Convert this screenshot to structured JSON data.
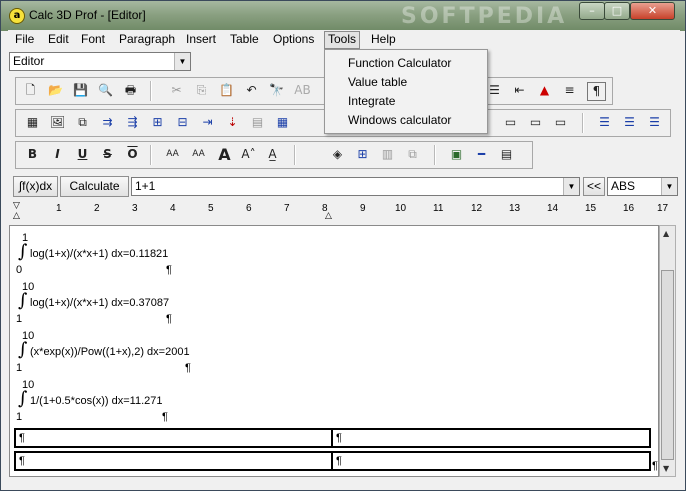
{
  "window": {
    "title": "Calc 3D Prof - [Editor]",
    "watermark": "SOFTPEDIA",
    "caption_minimize": "–",
    "caption_maximize": "□",
    "caption_close": "✕"
  },
  "menubar": [
    "File",
    "Edit",
    "Font",
    "Paragraph",
    "Insert",
    "Table",
    "Options",
    "Tools",
    "Help"
  ],
  "style_combo": {
    "value": "Editor"
  },
  "tools_menu": {
    "items": [
      "Function Calculator",
      "Value table",
      "Integrate",
      "Windows calculator"
    ]
  },
  "formula_bar": {
    "integral_button": "∫f(x)dx",
    "calculate_button": "Calculate",
    "expression": "1+1",
    "back_button": "<<",
    "function_combo": "ABS"
  },
  "ruler": {
    "labels": [
      "1",
      "2",
      "3",
      "4",
      "5",
      "6",
      "7",
      "8",
      "9",
      "10",
      "11",
      "12",
      "13",
      "14",
      "15",
      "16",
      "17"
    ]
  },
  "document": {
    "integrals": [
      {
        "upper": "1",
        "lower": "0",
        "expression": "log(1+x)/(x*x+1) dx=0.11821"
      },
      {
        "upper": "10",
        "lower": "1",
        "expression": "log(1+x)/(x*x+1) dx=0.37087"
      },
      {
        "upper": "10",
        "lower": "1",
        "expression": "(x*exp(x))/Pow((1+x),2) dx=2001"
      },
      {
        "upper": "10",
        "lower": "1",
        "expression": "1/(1+0.5*cos(x)) dx=11.271"
      }
    ],
    "pilcrow": "¶",
    "table_cells": [
      "¶",
      "¶",
      "¶",
      "¶"
    ]
  },
  "icons": {
    "toolbar1": [
      "new-file",
      "open-folder",
      "save",
      "print-preview",
      "print",
      "cut",
      "copy",
      "paste",
      "undo",
      "find",
      "spell-check",
      "align-right",
      "indent",
      "fill-color",
      "styles",
      "paragraph-mark"
    ],
    "toolbar2": [
      "table",
      "insert-image",
      "object",
      "row-insert",
      "column-insert",
      "cell-merge",
      "cell-split",
      "align-bottom",
      "sort",
      "grid",
      "table-grid",
      "frame-top",
      "frame-bottom",
      "frame-middle",
      "bullet-list",
      "number-list",
      "outline-list"
    ],
    "toolbar3": [
      "bold",
      "italic",
      "underline",
      "strikethrough",
      "overline",
      "font-grow",
      "font-shrink",
      "text-large",
      "superscript",
      "subscript",
      "color-fill",
      "grid-view",
      "chart",
      "stack",
      "picture",
      "line",
      "page"
    ]
  }
}
